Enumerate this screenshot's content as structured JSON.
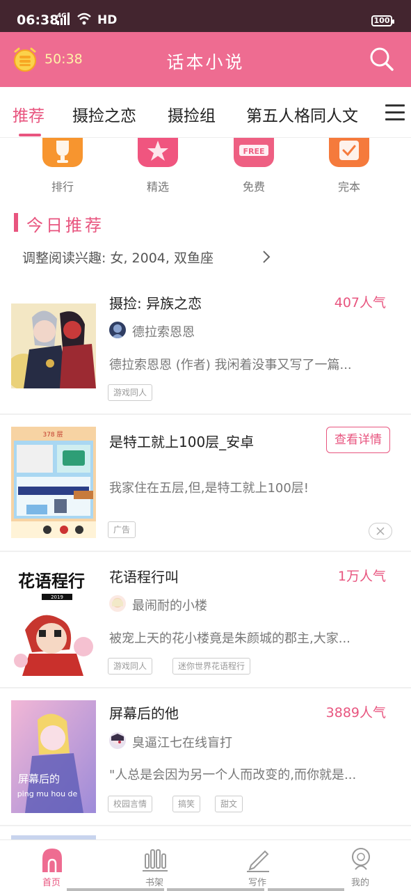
{
  "status_bar": {
    "time": "06:38",
    "network": "4G",
    "hd": "HD",
    "battery": "100"
  },
  "header": {
    "timer": "50:38",
    "title": "话本小说",
    "accent_color": "#ee6c91"
  },
  "tabs": [
    {
      "label": "推荐",
      "active": true
    },
    {
      "label": "摄捡之恋",
      "active": false
    },
    {
      "label": "摄捡组",
      "active": false
    },
    {
      "label": "第五人格同人文",
      "active": false
    }
  ],
  "categories": [
    {
      "label": "排行",
      "icon": "trophy-icon",
      "color": "#f7952f"
    },
    {
      "label": "精选",
      "icon": "star-icon",
      "color": "#f0557f"
    },
    {
      "label": "免费",
      "icon": "free-icon",
      "color": "#ee5f82",
      "badge": "FREE"
    },
    {
      "label": "完本",
      "icon": "check-icon",
      "color": "#f57a3c"
    }
  ],
  "section": {
    "title": "今日推荐",
    "preference": "调整阅读兴趣: 女, 2004, 双鱼座"
  },
  "books": [
    {
      "title": "摄捡: 异族之恋",
      "popularity": "407人气",
      "author": "德拉索恩恩",
      "description": "德拉索恩恩 (作者) 我闲着没事又写了一篇...",
      "tags": [
        "游戏同人"
      ]
    },
    {
      "title": "是特工就上100层_安卓",
      "description": "我家住在五层,但,是特工就上100层!",
      "detail_button": "查看详情",
      "ad_label": "广告",
      "cover_caption": "378 层",
      "is_ad": true
    },
    {
      "title": "花语程行叫",
      "popularity": "1万人气",
      "author": "最闹耐的小楼",
      "description": "被宠上天的花小楼竟是朱颜城的郡主,大家...",
      "tags": [
        "游戏同人",
        "迷你世界花语程行"
      ],
      "cover_text": "花语程行",
      "cover_year": "2019"
    },
    {
      "title": "屏幕后的他",
      "popularity": "3889人气",
      "author": "臭逼江七在线盲打",
      "description": "\"人总是会因为另一个人而改变的,而你就是...",
      "tags": [
        "校园言情",
        "搞笑",
        "甜文"
      ],
      "cover_text": "屏幕后的",
      "cover_sub": "ping mu hou de"
    }
  ],
  "bottom_nav": [
    {
      "label": "首页",
      "icon": "home-icon",
      "active": true
    },
    {
      "label": "书架",
      "icon": "bookshelf-icon",
      "active": false
    },
    {
      "label": "写作",
      "icon": "pen-icon",
      "active": false
    },
    {
      "label": "我的",
      "icon": "profile-icon",
      "active": false
    }
  ]
}
